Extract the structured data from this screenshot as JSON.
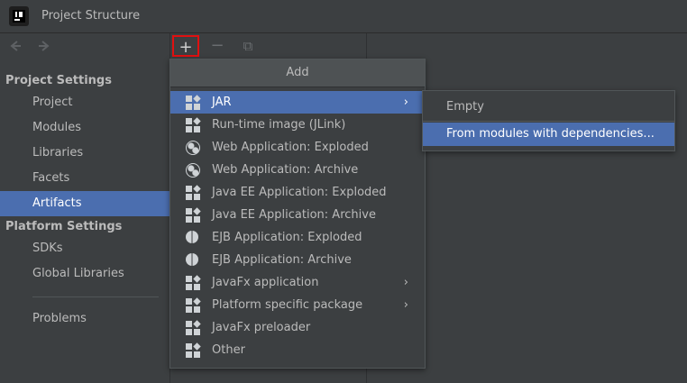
{
  "window": {
    "title": "Project Structure",
    "app_icon": "intellij-icon"
  },
  "sidebar": {
    "nav": {
      "back_icon": "back-arrow-icon",
      "forward_icon": "forward-arrow-icon"
    },
    "project_settings_header": "Project Settings",
    "project_items": [
      {
        "label": "Project"
      },
      {
        "label": "Modules"
      },
      {
        "label": "Libraries"
      },
      {
        "label": "Facets"
      },
      {
        "label": "Artifacts",
        "selected": true
      }
    ],
    "platform_settings_header": "Platform Settings",
    "platform_items": [
      {
        "label": "SDKs"
      },
      {
        "label": "Global Libraries"
      }
    ],
    "problems_label": "Problems"
  },
  "toolbar": {
    "add_symbol": "+",
    "remove_symbol": "−",
    "copy_symbol": "⧉"
  },
  "add_popup": {
    "title": "Add",
    "items": [
      {
        "label": "JAR",
        "icon": "jar-icon",
        "has_submenu": true,
        "selected": true
      },
      {
        "label": "Run-time image (JLink)",
        "icon": "jar-icon"
      },
      {
        "label": "Web Application: Exploded",
        "icon": "web-globe-icon"
      },
      {
        "label": "Web Application: Archive",
        "icon": "web-globe-icon"
      },
      {
        "label": "Java EE Application: Exploded",
        "icon": "jar-icon"
      },
      {
        "label": "Java EE Application: Archive",
        "icon": "jar-icon"
      },
      {
        "label": "EJB Application: Exploded",
        "icon": "ejb-bean-icon"
      },
      {
        "label": "EJB Application: Archive",
        "icon": "ejb-bean-icon"
      },
      {
        "label": "JavaFx application",
        "icon": "jar-icon",
        "has_submenu": true
      },
      {
        "label": "Platform specific package",
        "icon": "jar-icon",
        "has_submenu": true
      },
      {
        "label": "JavaFx preloader",
        "icon": "jar-icon"
      },
      {
        "label": "Other",
        "icon": "jar-icon"
      }
    ],
    "submenu_arrow": "›"
  },
  "jar_submenu": {
    "items": [
      {
        "label": "Empty"
      },
      {
        "label": "From modules with dependencies...",
        "selected": true
      }
    ]
  },
  "colors": {
    "selection": "#4b6eaf",
    "background": "#3c3f41",
    "highlight_border": "#e01010"
  }
}
